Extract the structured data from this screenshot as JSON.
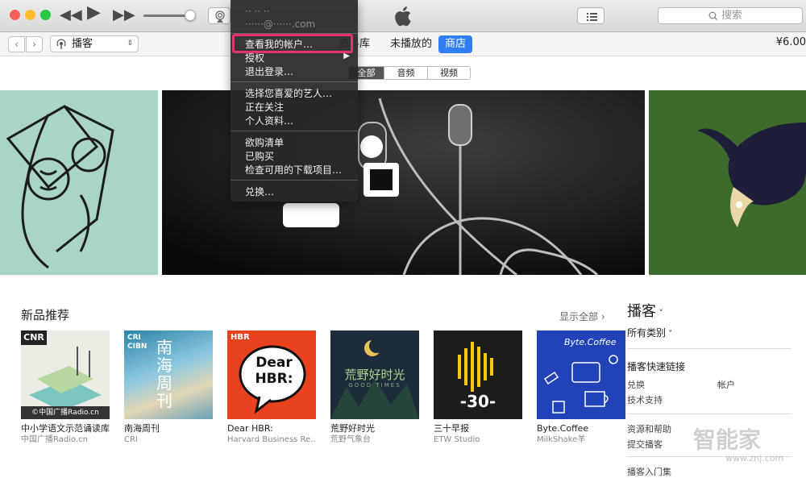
{
  "colors": {
    "accent": "#2f7ef5",
    "highlight": "#e8316f",
    "close": "#fc5f57",
    "minimize": "#fdbc2e",
    "zoom": "#28c840"
  },
  "titlebar": {
    "search_placeholder": "搜索"
  },
  "navbar": {
    "media_type": "播客",
    "tabs": [
      {
        "label": "资料库"
      },
      {
        "label": "未播放的"
      },
      {
        "label": "商店"
      }
    ],
    "price": "¥6.00"
  },
  "segments": [
    "全部",
    "音频",
    "视频"
  ],
  "account_menu": {
    "user_name": "·· ·· ··",
    "user_email": "······@······.com",
    "items": [
      {
        "label": "查看我的帐户…"
      },
      {
        "label": "授权"
      },
      {
        "label": "退出登录…"
      },
      {
        "label": "选择您喜爱的艺人…"
      },
      {
        "label": "正在关注"
      },
      {
        "label": "个人资料…"
      },
      {
        "label": "欲购清单"
      },
      {
        "label": "已购买"
      },
      {
        "label": "检查可用的下载项目…"
      },
      {
        "label": "兑换…"
      }
    ]
  },
  "new_releases": {
    "title": "新品推荐",
    "see_all": "显示全部",
    "items": [
      {
        "title": "中小学语文示范诵读库",
        "author": "中国广播Radio.cn",
        "art_text": "CNR",
        "art_sub": "©中国广播Radio.cn"
      },
      {
        "title": "南海周刊",
        "author": "CRI",
        "art_text": "南海周刊",
        "art_sub": "CRI CIBN"
      },
      {
        "title": "Dear HBR:",
        "author": "Harvard Business Re...",
        "art_text": "Dear HBR:",
        "art_sub": "HBR"
      },
      {
        "title": "荒野好时光",
        "author": "荒野气象台",
        "art_text": "荒野好时光",
        "art_sub": "GOOD TIMES"
      },
      {
        "title": "三十早报",
        "author": "ETW Studio",
        "art_text": "-30-",
        "art_sub": ""
      },
      {
        "title": "Byte.Coffee",
        "author": "MilkShake羊",
        "art_text": "Byte.Coffee",
        "art_sub": ""
      }
    ]
  },
  "sidebar": {
    "title": "播客",
    "category": "所有类别",
    "quick_links_title": "播客快速链接",
    "links": [
      "兑换",
      "帐户",
      "技术支持"
    ],
    "resources_title": "资源和帮助",
    "resources": [
      "提交播客"
    ],
    "more": "播客入门集"
  },
  "watermark": {
    "text": "智能家",
    "url": "www.znj.com"
  }
}
